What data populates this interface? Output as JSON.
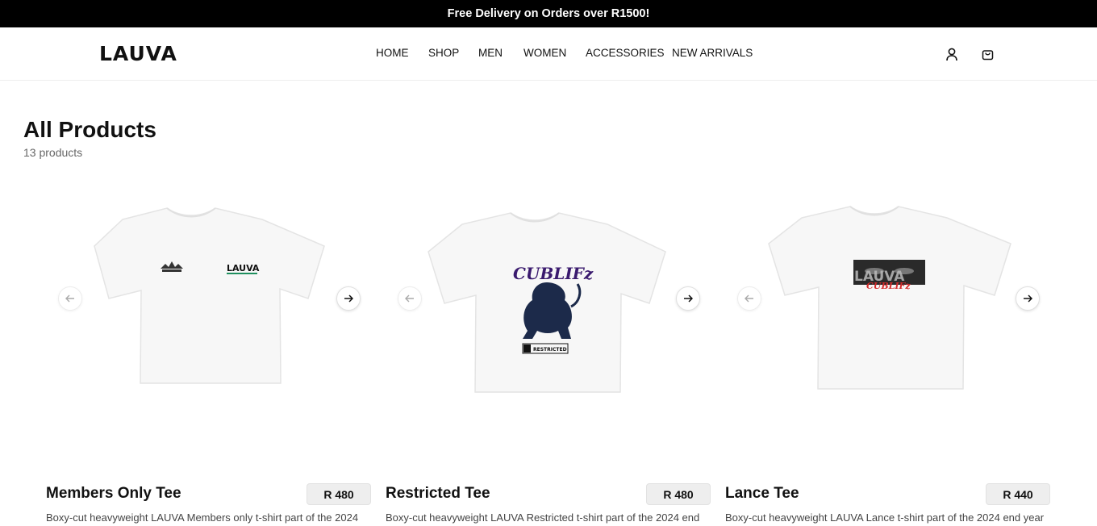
{
  "announcement": "Free Delivery on Orders over R1500!",
  "brand": {
    "logo": "LAUVA"
  },
  "nav": [
    "HOME",
    "SHOP",
    "MEN",
    "WOMEN",
    "ACCESSORIES",
    "NEW ARRIVALS"
  ],
  "header_icons": [
    "user-icon",
    "cart-icon"
  ],
  "collection": {
    "title": "All Products",
    "count": "13 products"
  },
  "products": [
    {
      "name": "Members Only Tee",
      "price": "R 480",
      "description": "Boxy-cut heavyweight LAUVA Members only t-shirt part of the 2024",
      "print_text": "LAUVA",
      "accent": "#1f8f5e"
    },
    {
      "name": "Restricted Tee",
      "price": "R 480",
      "description": "Boxy-cut heavyweight LAUVA Restricted t-shirt part of the 2024 end",
      "print_text": "CUBLIFz",
      "print_label": "RESTRICTED",
      "accent": "#3a1a6e"
    },
    {
      "name": "Lance Tee",
      "price": "R 440",
      "description": "Boxy-cut heavyweight LAUVA Lance t-shirt part of the 2024 end year",
      "print_text": "LAUVA",
      "print_subtext": "CUBLIFz",
      "accent": "#d42a2a"
    }
  ],
  "colors": {
    "bar": "#000000",
    "text": "#111111",
    "muted": "#666666",
    "price_bg": "#eeeeee"
  }
}
